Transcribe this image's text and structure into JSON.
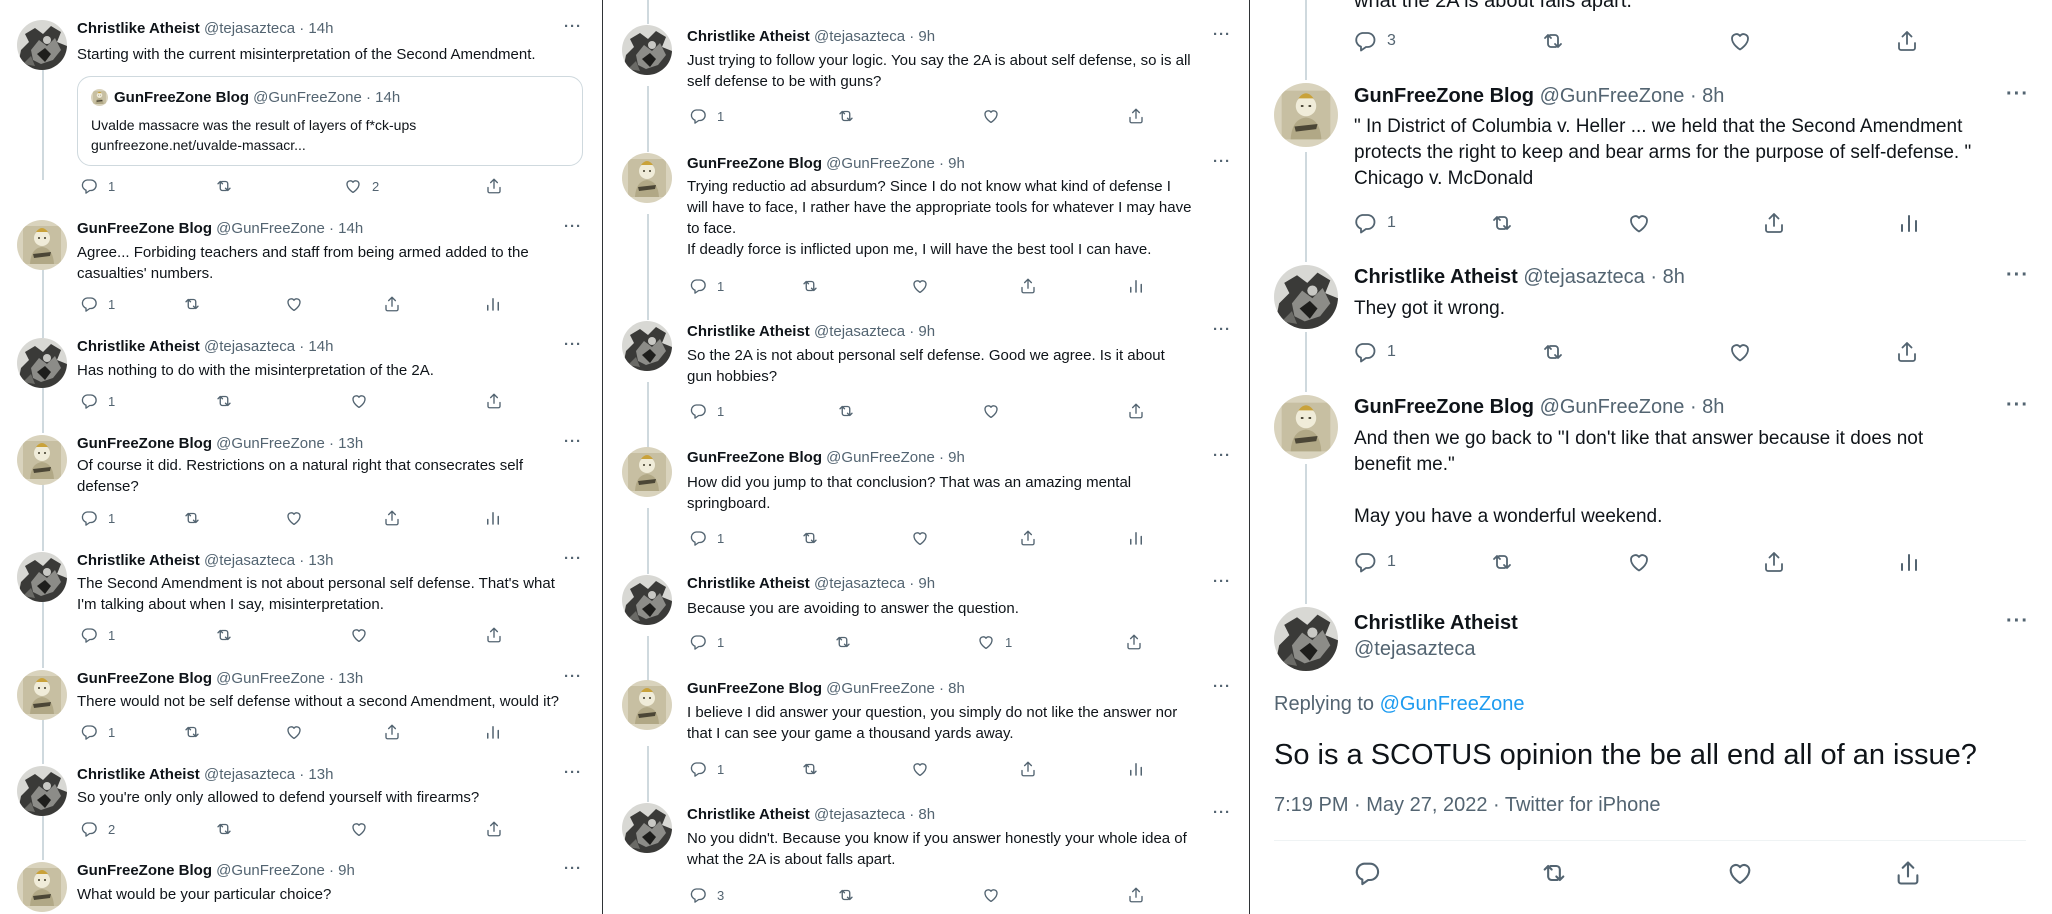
{
  "users": {
    "ca": {
      "name": "Christlike Atheist",
      "handle": "@tejasazteca"
    },
    "gfz": {
      "name": "GunFreeZone Blog",
      "handle": "@GunFreeZone"
    }
  },
  "colors": {
    "text": "#0f1419",
    "muted": "#536471",
    "link": "#1d9bf0",
    "thread": "#cfd9de"
  },
  "icons": {
    "more": "more-icon",
    "reply": "reply-icon",
    "retweet": "retweet-icon",
    "like": "like-icon",
    "share": "share-icon",
    "analytics": "analytics-icon"
  },
  "more_glyph": "···",
  "col1": {
    "t1": {
      "time": "· 14h",
      "text": "Starting with the current misinterpretation of the Second Amendment.",
      "quote": {
        "name": "GunFreeZone Blog",
        "handle": "@GunFreeZone",
        "time": "· 14h",
        "line1": "Uvalde massacre was the result of layers of f*ck-ups",
        "line2": "gunfreezone.net/uvalde-massacr..."
      },
      "replies": "1",
      "likes": "2"
    },
    "t2": {
      "time": "· 14h",
      "text": "Agree... Forbiding teachers and staff from being armed added to the\ncasualties' numbers.",
      "replies": "1"
    },
    "t3": {
      "time": "· 14h",
      "text": "Has nothing to do with the misinterpretation of the 2A.",
      "replies": "1"
    },
    "t4": {
      "time": "· 13h",
      "text": "Of course it did. Restrictions on a natural right that consecrates self\ndefense?",
      "replies": "1"
    },
    "t5": {
      "time": "· 13h",
      "text": "The Second Amendment is not about personal self defense. That's what\nI'm talking about when I say, misinterpretation.",
      "replies": "1"
    },
    "t6": {
      "time": "· 13h",
      "text": "There would not be self defense without a second Amendment, would it?",
      "replies": "1"
    },
    "t7": {
      "time": "· 13h",
      "text": "So you're only only allowed to defend yourself with firearms?",
      "replies": "2"
    },
    "t8": {
      "time": "· 9h",
      "text": "What would be your particular choice?"
    }
  },
  "col2": {
    "t1": {
      "time": "· 9h",
      "text": "Just trying to follow your logic. You say the 2A is about self defense, so is all\nself defense to be with guns?",
      "replies": "1"
    },
    "t2": {
      "time": "· 9h",
      "text": "Trying reductio ad absurdum? Since I do not know what kind of defense I\nwill have to face, I rather have the appropriate tools for whatever I may have\nto face.\nIf deadly force is inflicted upon me, I will have the best tool I can have.",
      "replies": "1"
    },
    "t3": {
      "time": "· 9h",
      "text": "So the 2A is not about personal self defense. Good we agree. Is it about\ngun hobbies?",
      "replies": "1"
    },
    "t4": {
      "time": "· 9h",
      "text": "How did you jump to that conclusion? That was an amazing mental\nspringboard.",
      "replies": "1"
    },
    "t5": {
      "time": "· 9h",
      "text": "Because you are avoiding to answer the question.",
      "replies": "1",
      "likes": "1"
    },
    "t6": {
      "time": "· 8h",
      "text": "I believe I did answer your question, you simply do not like the answer nor\nthat I can see your game a thousand yards away.",
      "replies": "1"
    },
    "t7": {
      "time": "· 8h",
      "text": "No you didn't. Because you know if you answer honestly your whole idea of\nwhat the 2A is about falls apart.",
      "replies": "3"
    }
  },
  "col3": {
    "cut_text": "what the 2A is about falls apart.",
    "cut_replies": "3",
    "t1": {
      "time": "· 8h",
      "text": "\" In District of Columbia v. Heller ... we held that the Second Amendment\nprotects the right to keep and bear arms for the purpose of self-defense. \"\nChicago v. McDonald",
      "replies": "1"
    },
    "t2": {
      "time": "· 8h",
      "text": "They got it wrong.",
      "replies": "1"
    },
    "t3": {
      "time": "· 8h",
      "text": "And then we go back to \"I don't like that answer because it does not\nbenefit me.\"\n\nMay you have a wonderful weekend.",
      "replies": "1"
    },
    "main": {
      "replying_prefix": "Replying to",
      "replying_to": "@GunFreeZone",
      "text": "So is a SCOTUS opinion the be all end all of an issue?",
      "meta": "7:19 PM · May 27, 2022 · Twitter for iPhone"
    }
  }
}
